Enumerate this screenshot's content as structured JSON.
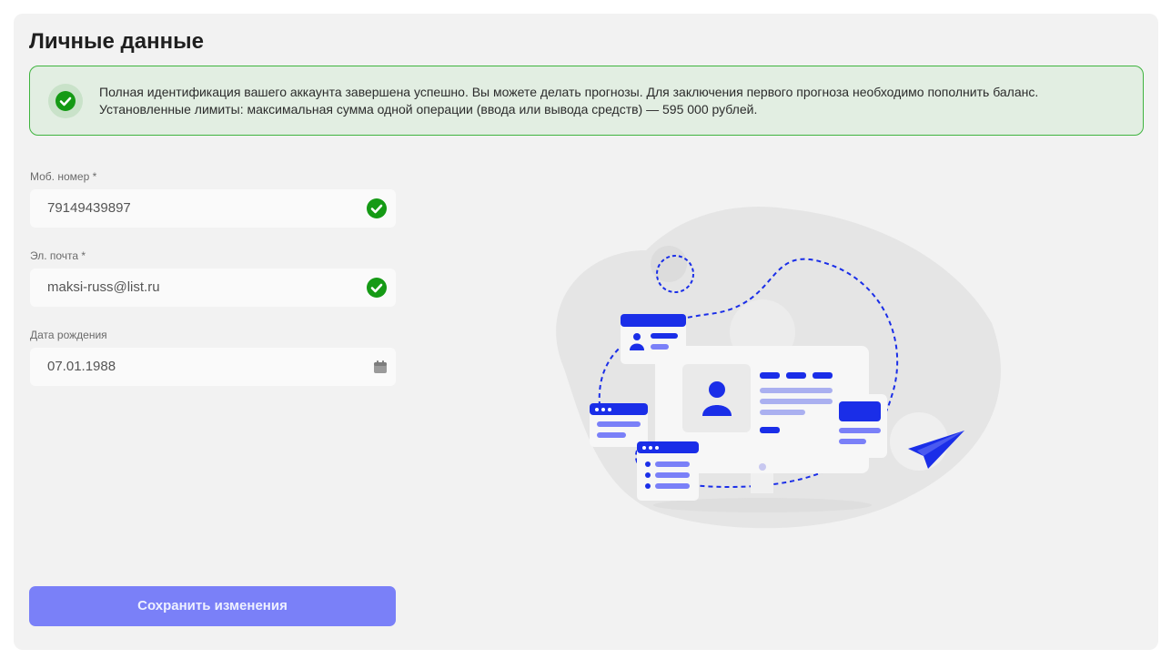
{
  "page": {
    "title": "Личные данные"
  },
  "alert": {
    "text": "Полная идентификация вашего аккаунта завершена успешно. Вы можете делать прогнозы. Для заключения первого прогноза необходимо пополнить баланс. Установленные лимиты: максимальная сумма одной операции (ввода или вывода средств) — 595 000 рублей.",
    "icon": "check-circle-icon",
    "color": "#159a15"
  },
  "form": {
    "phone": {
      "label": "Моб. номер *",
      "value": "79149439897",
      "verified": true
    },
    "email": {
      "label": "Эл. почта *",
      "value": "maksi-russ@list.ru",
      "verified": true
    },
    "birthdate": {
      "label": "Дата рождения",
      "value": "07.01.1988"
    },
    "save_label": "Сохранить изменения"
  },
  "colors": {
    "accent": "#7a80f8",
    "brand": "#1a2ee8",
    "success": "#159a15"
  }
}
